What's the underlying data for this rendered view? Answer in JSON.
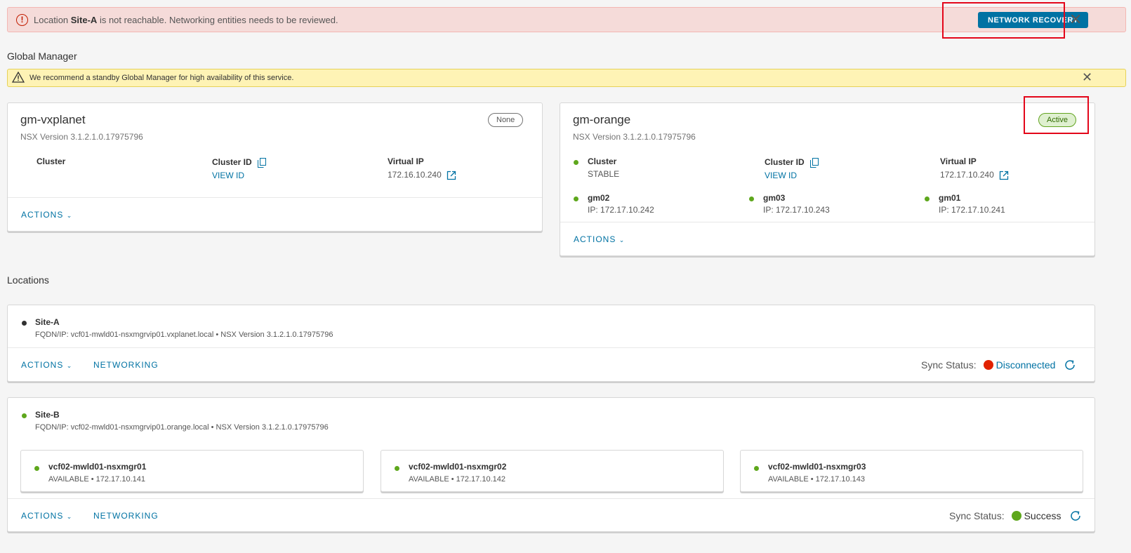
{
  "banner": {
    "prefix": "Location ",
    "site": "Site-A",
    "suffix": " is not reachable. Networking entities needs to be reviewed.",
    "button": "NETWORK RECOVERY",
    "icon": "error-circle-icon"
  },
  "global_manager": {
    "title": "Global Manager",
    "warning": "We recommend a standby Global Manager for high availability of this service.",
    "cards": [
      {
        "name": "gm-vxplanet",
        "version": "NSX Version  3.1.2.1.0.17975796",
        "badge": "None",
        "cluster_label": "Cluster",
        "cluster_status": "",
        "cluster_id_label": "Cluster ID",
        "cluster_id_link": "VIEW ID",
        "vip_label": "Virtual IP",
        "vip": "172.16.10.240",
        "actions": "ACTIONS"
      },
      {
        "name": "gm-orange",
        "version": "NSX Version  3.1.2.1.0.17975796",
        "badge": "Active",
        "cluster_label": "Cluster",
        "cluster_status": "STABLE",
        "cluster_id_label": "Cluster ID",
        "cluster_id_link": "VIEW ID",
        "vip_label": "Virtual IP",
        "vip": "172.17.10.240",
        "nodes": [
          {
            "name": "gm02",
            "ip": "IP: 172.17.10.242"
          },
          {
            "name": "gm03",
            "ip": "IP: 172.17.10.243"
          },
          {
            "name": "gm01",
            "ip": "IP: 172.17.10.241"
          }
        ],
        "actions": "ACTIONS"
      }
    ]
  },
  "locations": {
    "title": "Locations",
    "sync_label": "Sync Status:",
    "items": [
      {
        "name": "Site-A",
        "fqdn": "FQDN/IP: vcf01-mwld01-nsxmgrvip01.vxplanet.local • NSX Version 3.1.2.1.0.17975796",
        "actions": "ACTIONS",
        "networking": "NETWORKING",
        "sync_status": "Disconnected",
        "status_color": "#e12200"
      },
      {
        "name": "Site-B",
        "fqdn": "FQDN/IP: vcf02-mwld01-nsxmgrvip01.orange.local • NSX Version 3.1.2.1.0.17975796",
        "managers": [
          {
            "name": "vcf02-mwld01-nsxmgr01",
            "status": "AVAILABLE • 172.17.10.141"
          },
          {
            "name": "vcf02-mwld01-nsxmgr02",
            "status": "AVAILABLE • 172.17.10.142"
          },
          {
            "name": "vcf02-mwld01-nsxmgr03",
            "status": "AVAILABLE • 172.17.10.143"
          }
        ],
        "actions": "ACTIONS",
        "networking": "NETWORKING",
        "sync_status": "Success",
        "status_color": "#5ea71c"
      }
    ]
  }
}
